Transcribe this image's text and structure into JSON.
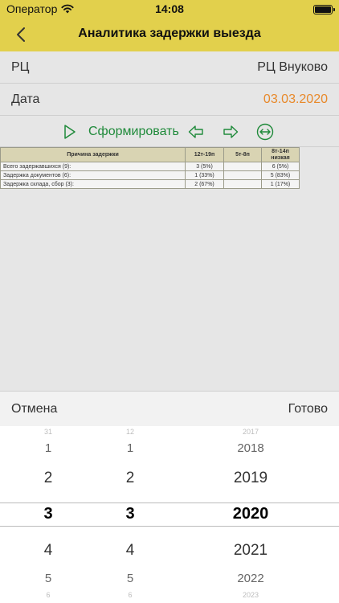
{
  "status_bar": {
    "carrier": "Оператор",
    "time": "14:08"
  },
  "nav": {
    "title": "Аналитика задержки выезда",
    "back_icon": "chevron-left-icon"
  },
  "form": {
    "rc_label": "РЦ",
    "rc_value": "РЦ Внуково",
    "date_label": "Дата",
    "date_value": "03.03.2020"
  },
  "toolbar": {
    "generate_label": "Сформировать"
  },
  "colors": {
    "accent_yellow": "#e2d04c",
    "green": "#1f8a3a",
    "date_orange": "#e8892a"
  },
  "report": {
    "headers": [
      "Причина задержки",
      "12т-19п",
      "5т-8п",
      "8т-14п низкая"
    ],
    "rows": [
      [
        "Всего задержавшихся (9):",
        "3 (5%)",
        "",
        "6 (5%)"
      ],
      [
        "Задержка документов (6):",
        "1 (33%)",
        "",
        "5 (83%)"
      ],
      [
        "Задержка склада, сбор (3):",
        "2 (67%)",
        "",
        "1 (17%)"
      ]
    ]
  },
  "picker": {
    "cancel_label": "Отмена",
    "done_label": "Готово",
    "day": [
      "31",
      "1",
      "2",
      "3",
      "4",
      "5",
      "6"
    ],
    "month": [
      "12",
      "1",
      "2",
      "3",
      "4",
      "5",
      "6"
    ],
    "year": [
      "2017",
      "2018",
      "2019",
      "2020",
      "2021",
      "2022",
      "2023"
    ]
  }
}
